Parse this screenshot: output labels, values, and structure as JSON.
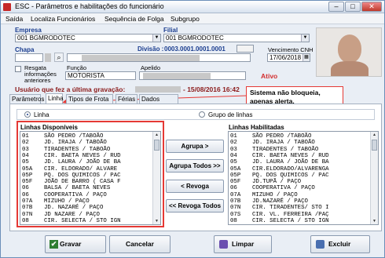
{
  "window": {
    "title": "ESC - Parâmetros e habilitações do funcionário",
    "minimize": "–",
    "maximize": "□",
    "close": "✕",
    "close_color": "#c0392b"
  },
  "menu": {
    "items": [
      "Saída",
      "Localiza Funcionários",
      "Sequência de Folga",
      "Subgrupo"
    ]
  },
  "form": {
    "empresa_label": "Empresa",
    "empresa_value": "001 BGMRODOTEC",
    "filial_label": "Filial",
    "filial_value": "001 BGMRODOTEC",
    "chapa_label": "Chapa",
    "divisao_label": "Divisão :",
    "divisao_value": "0003.0001.0001.0001",
    "vencimento_label": "Vencimento CNH",
    "vencimento_value": "17/06/2018",
    "resgata_label": "Resgata informações anteriores",
    "funcao_label": "Função",
    "funcao_value": "MOTORISTA",
    "apelido_label": "Apelido",
    "ativo_label": "Ativo",
    "usuario_label": "Usuário que fez a última gravação:",
    "usuario_value": "- 15/08/2016 16:42"
  },
  "callout": {
    "text": "Sistema não bloqueia, apenas alerta."
  },
  "tabs": [
    "Parâmetros",
    "Linha",
    "Tipos de Frota",
    "Férias",
    "Dados Gerais"
  ],
  "radios": {
    "linha": "Linha",
    "grupo": "Grupo de linhas"
  },
  "lists": {
    "disponiveis_label": "Linhas Disponíveis",
    "habilitadas_label": "Linhas Habilitadas",
    "disponiveis": [
      [
        "01",
        "SÃO PEDRO /TABOÃO"
      ],
      [
        "02",
        "JD. IRAJA / TABOÃO"
      ],
      [
        "03",
        "TIRADENTES / TABOÃO"
      ],
      [
        "04",
        "CIR. BAETA NEVES / RUD"
      ],
      [
        "05",
        "JD. LAURA / JOÃO DE BA"
      ],
      [
        "05A",
        "CIR. ELDORADO/ ALVARE"
      ],
      [
        "05P",
        "PQ. DOS QUIMICOS / PAC"
      ],
      [
        "05F",
        "JOÃO DE BARRO ( CASA F"
      ],
      [
        "06",
        "BALSA / BAETA NEVES"
      ],
      [
        "06",
        "COOPERATIVA / PAÇO"
      ],
      [
        "07A",
        "MIZUHO / PAÇO"
      ],
      [
        "07B",
        "JD. NAZARÉ / PAÇO"
      ],
      [
        "07N",
        "JD NAZARE / PAÇO"
      ],
      [
        "08",
        "CIR. SELECTA / STO IGN"
      ]
    ],
    "habilitadas": [
      [
        "01",
        "SÃO PEDRO /TABOÃO"
      ],
      [
        "02",
        "JD. IRAJA / TABOÃO"
      ],
      [
        "03",
        "TIRADENTES / TABOÃO"
      ],
      [
        "04",
        "CIR. BAETA NEVES / RUD"
      ],
      [
        "05",
        "JD. LAURA / JOÃO DE BA"
      ],
      [
        "05A",
        "CIR.ELDORADO/ALVARENGA"
      ],
      [
        "05P",
        "PQ. DOS QUIMICOS / PAC"
      ],
      [
        "05F",
        "JD.TUPÃ / PAÇO"
      ],
      [
        "06",
        "COOPERATIVA / PAÇO"
      ],
      [
        "07A",
        "MIZUHO / PAÇO"
      ],
      [
        "07B",
        "JD.NAZARÉ / PAÇO"
      ],
      [
        "07N",
        "CIR. TIRADENTES/ STO I"
      ],
      [
        "07S",
        "CIR. VL. FERREIRA /PAÇ"
      ],
      [
        "08",
        "CIR. SELECTA / STO IGN"
      ]
    ]
  },
  "transfer": {
    "agrupa": "Agrupa >",
    "agrupa_todos": "Agrupa Todos >>",
    "revoga": "< Revoga",
    "revoga_todos": "<< Revoga Todos"
  },
  "bottom": {
    "gravar": "Gravar",
    "cancelar": "Cancelar",
    "limpar": "Limpar",
    "excluir": "Excluir"
  },
  "colors": {
    "accent_blue": "#1a3d8f",
    "alert_red": "#e53935",
    "ativo_red": "#d32f2f",
    "usuario_brown": "#8b1a1a"
  }
}
